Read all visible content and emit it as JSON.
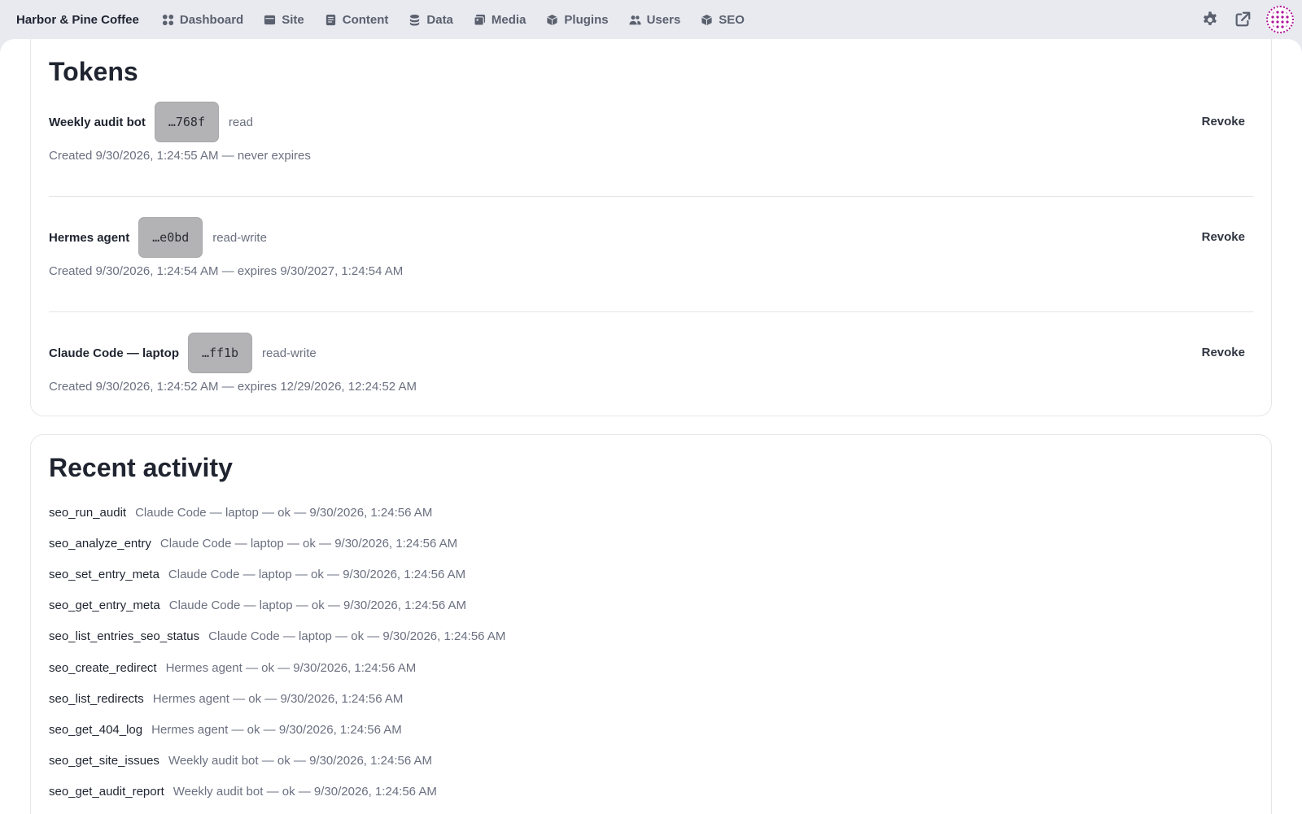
{
  "brand": "Harbor & Pine Coffee",
  "nav": [
    {
      "label": "Dashboard",
      "icon": "dashboard-icon"
    },
    {
      "label": "Site",
      "icon": "site-icon"
    },
    {
      "label": "Content",
      "icon": "content-icon"
    },
    {
      "label": "Data",
      "icon": "data-icon"
    },
    {
      "label": "Media",
      "icon": "media-icon"
    },
    {
      "label": "Plugins",
      "icon": "plugins-icon"
    },
    {
      "label": "Users",
      "icon": "users-icon"
    },
    {
      "label": "SEO",
      "icon": "seo-icon"
    }
  ],
  "top_actions": {
    "settings_icon": "gear-icon",
    "external_icon": "external-link-icon",
    "avatar_icon": "avatar"
  },
  "tokens": {
    "title": "Tokens",
    "revoke_label": "Revoke",
    "items": [
      {
        "name": "Weekly audit bot",
        "suffix": "…768f",
        "scope": "read",
        "meta": "Created 9/30/2026, 1:24:55 AM — never expires"
      },
      {
        "name": "Hermes agent",
        "suffix": "…e0bd",
        "scope": "read-write",
        "meta": "Created 9/30/2026, 1:24:54 AM — expires 9/30/2027, 1:24:54 AM"
      },
      {
        "name": "Claude Code — laptop",
        "suffix": "…ff1b",
        "scope": "read-write",
        "meta": "Created 9/30/2026, 1:24:52 AM — expires 12/29/2026, 12:24:52 AM"
      }
    ]
  },
  "activity": {
    "title": "Recent activity",
    "items": [
      {
        "tool": "seo_run_audit",
        "desc": "Claude Code — laptop — ok — 9/30/2026, 1:24:56 AM"
      },
      {
        "tool": "seo_analyze_entry",
        "desc": "Claude Code — laptop — ok — 9/30/2026, 1:24:56 AM"
      },
      {
        "tool": "seo_set_entry_meta",
        "desc": "Claude Code — laptop — ok — 9/30/2026, 1:24:56 AM"
      },
      {
        "tool": "seo_get_entry_meta",
        "desc": "Claude Code — laptop — ok — 9/30/2026, 1:24:56 AM"
      },
      {
        "tool": "seo_list_entries_seo_status",
        "desc": "Claude Code — laptop — ok — 9/30/2026, 1:24:56 AM"
      },
      {
        "tool": "seo_create_redirect",
        "desc": "Hermes agent — ok — 9/30/2026, 1:24:56 AM"
      },
      {
        "tool": "seo_list_redirects",
        "desc": "Hermes agent — ok — 9/30/2026, 1:24:56 AM"
      },
      {
        "tool": "seo_get_404_log",
        "desc": "Hermes agent — ok — 9/30/2026, 1:24:56 AM"
      },
      {
        "tool": "seo_get_site_issues",
        "desc": "Weekly audit bot — ok — 9/30/2026, 1:24:56 AM"
      },
      {
        "tool": "seo_get_audit_report",
        "desc": "Weekly audit bot — ok — 9/30/2026, 1:24:56 AM"
      }
    ]
  }
}
